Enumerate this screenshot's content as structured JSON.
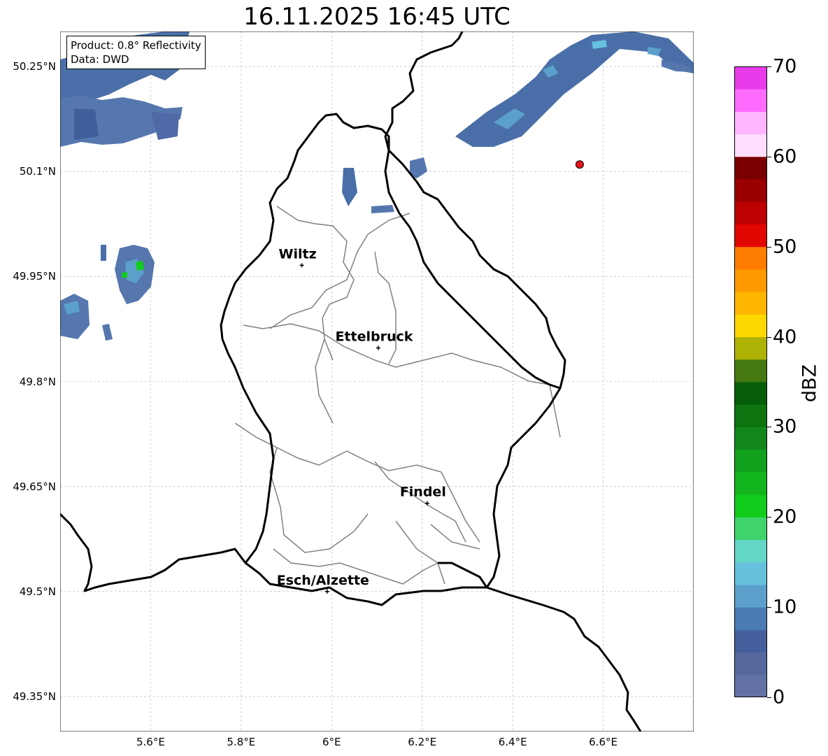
{
  "title": "16.11.2025 16:45 UTC",
  "info": {
    "product": "Product: 0.8° Reflectivity",
    "data": "Data: DWD"
  },
  "colorbar": {
    "label": "dBZ",
    "ticks": [
      "0",
      "10",
      "20",
      "30",
      "40",
      "50",
      "60",
      "70"
    ],
    "min": 0,
    "max": 70,
    "step": 2.5,
    "colors": [
      "#6272a6",
      "#56699f",
      "#465f9d",
      "#4a7bb3",
      "#5ba0cb",
      "#66c1dd",
      "#63d6c6",
      "#3ed46b",
      "#12cc1c",
      "#12b51c",
      "#12a11c",
      "#12861c",
      "#0d7410",
      "#065e09",
      "#457810",
      "#aeb204",
      "#fed800",
      "#feb600",
      "#fe9900",
      "#fe7d00",
      "#e20600",
      "#bd0000",
      "#9b0000",
      "#7a0000",
      "#ffdeff",
      "#ffb5ff",
      "#ff6bff",
      "#e83ceb"
    ]
  },
  "axes": {
    "lat_labels": [
      "50.25°N",
      "50.1°N",
      "49.95°N",
      "49.8°N",
      "49.65°N",
      "49.5°N",
      "49.35°N"
    ],
    "lon_labels": [
      "5.6°E",
      "5.8°E",
      "6°E",
      "6.2°E",
      "6.4°E",
      "6.6°E"
    ]
  },
  "cities": [
    {
      "name": "Wiltz",
      "lon": 5.934,
      "lat": 49.966
    },
    {
      "name": "Ettelbruck",
      "lon": 6.103,
      "lat": 49.848
    },
    {
      "name": "Findel",
      "lon": 6.211,
      "lat": 49.626
    },
    {
      "name": "Esch/Alzette",
      "lon": 5.99,
      "lat": 49.5
    }
  ],
  "radar_site": {
    "lon": 6.548,
    "lat": 50.11
  },
  "colors": {
    "border": "#000000",
    "canton": "#808080",
    "grid": "#b0b0b0",
    "radar_site": "#e8141e"
  }
}
